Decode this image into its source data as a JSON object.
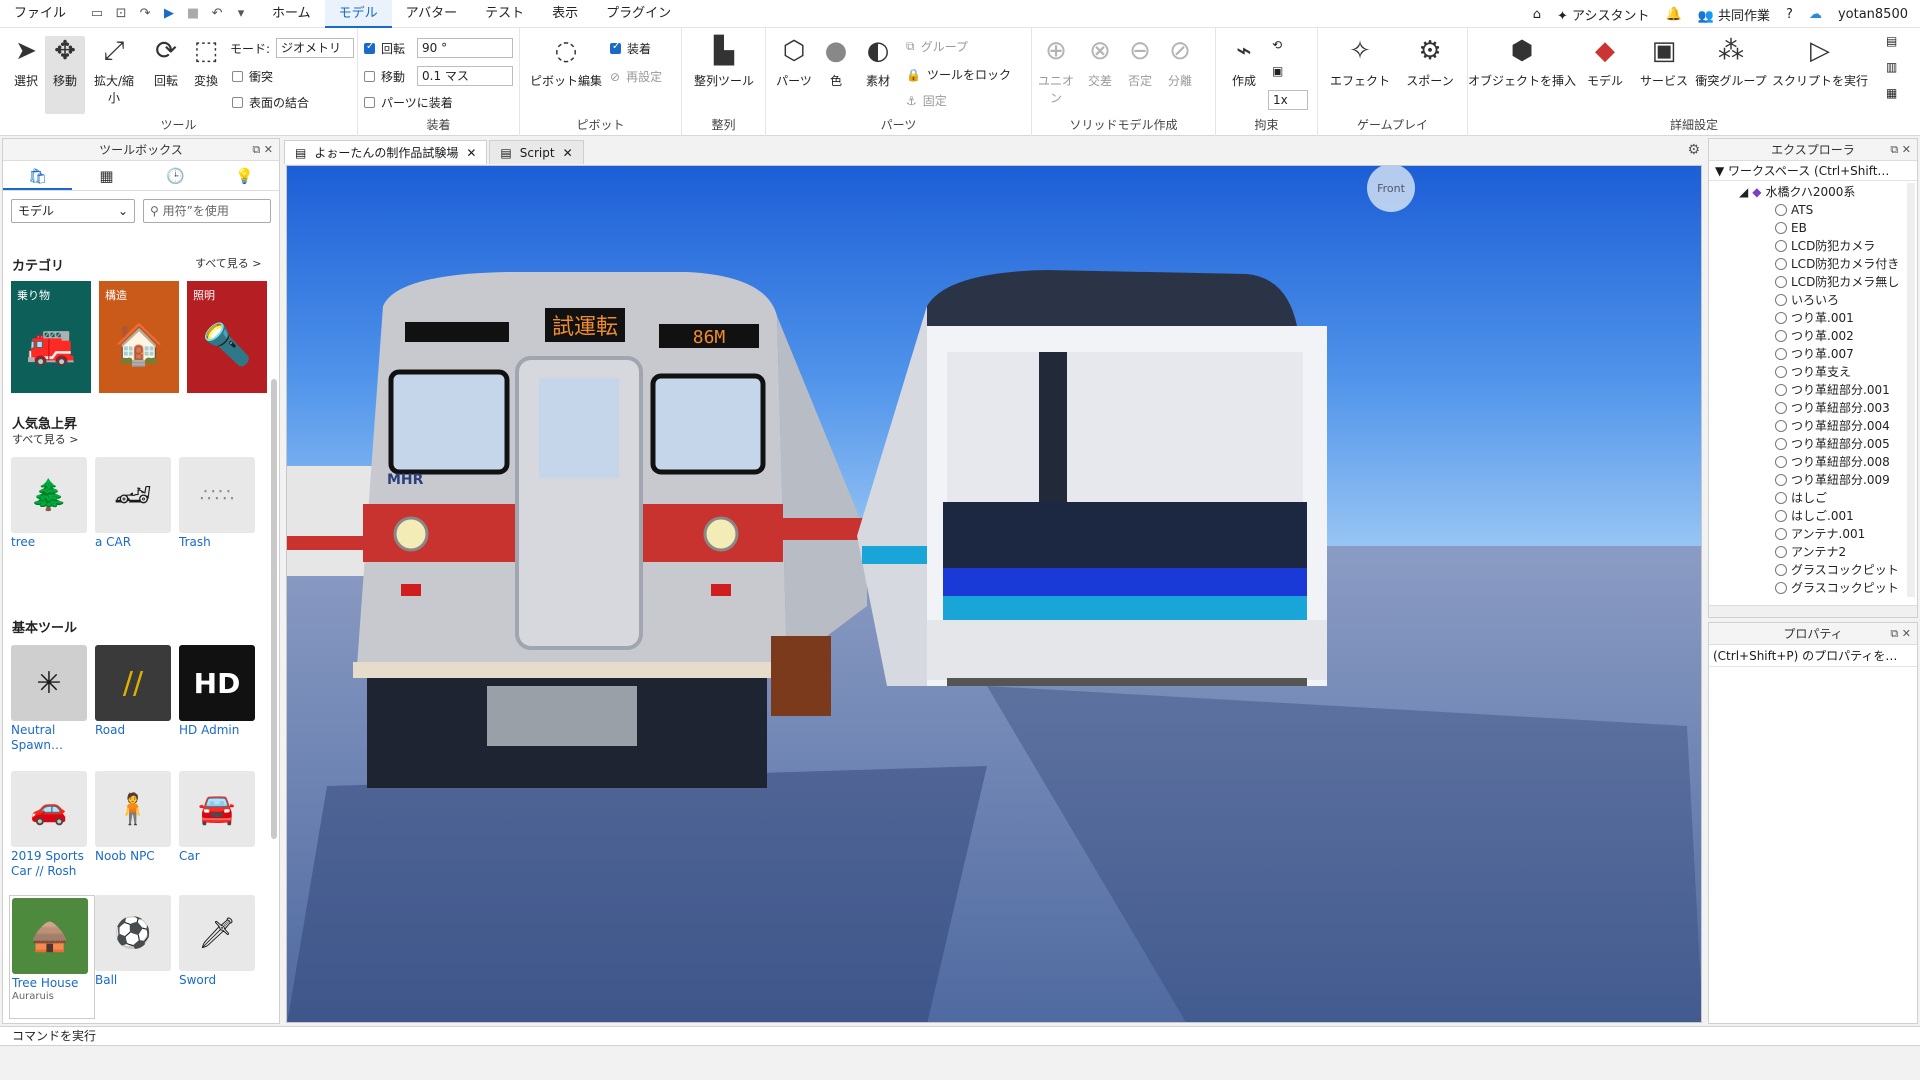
{
  "menubar": {
    "items": [
      "ファイル",
      "ホーム",
      "モデル",
      "アバター",
      "テスト",
      "表示",
      "プラグイン"
    ],
    "active_index": 2,
    "assistant": "アシスタント",
    "collab": "共同作業",
    "username": "yotan8500"
  },
  "ribbon": {
    "tools_group": {
      "label": "ツール",
      "select": "選択",
      "move": "移動",
      "scale": "拡大/縮小",
      "rotate": "回転",
      "transform": "変換",
      "mode_label": "モード:",
      "mode_value": "ジオメトリ",
      "collision": "衝突",
      "join_surfaces": "表面の結合"
    },
    "snap_group": {
      "label": "装着",
      "rotate_label": "回転",
      "rotate_value": "90 °",
      "move_label": "移動",
      "move_value": "0.1 マス",
      "attach_parts": "パーツに装着"
    },
    "pivot_group": {
      "label": "ピボット",
      "edit_pivot": "ピボット編集",
      "attach": "装着",
      "reset": "再設定"
    },
    "align_group": {
      "label": "整列",
      "align_tool": "整列ツール"
    },
    "parts_group": {
      "label": "パーツ",
      "part": "パーツ",
      "color": "色",
      "material": "素材",
      "group": "グループ",
      "lock_tool": "ツールをロック",
      "anchor": "固定"
    },
    "solid_group": {
      "label": "ソリッドモデル作成",
      "union": "ユニオン",
      "intersect": "交差",
      "negate": "否定",
      "separate": "分離"
    },
    "constraint_group": {
      "label": "拘束",
      "create": "作成",
      "scale_value": "1x"
    },
    "gameplay_group": {
      "label": "ゲームプレイ",
      "effects": "エフェクト",
      "spawn": "スポーン"
    },
    "advanced_group": {
      "label": "詳細設定",
      "insert_object": "オブジェクトを挿入",
      "model": "モデル",
      "service": "サービス",
      "collision_groups": "衝突グループ",
      "run_script": "スクリプトを実行"
    }
  },
  "toolbox": {
    "title": "ツールボックス",
    "dropdown": "モデル",
    "search_placeholder": "用符”を使用",
    "categories_heading": "カテゴリ",
    "see_all": "すべて見る >",
    "categories": [
      "乗り物",
      "構造",
      "照明"
    ],
    "trending_heading": "人気急上昇",
    "trending_see_all": "すべて見る >",
    "trending": [
      "tree",
      "a CAR",
      "Trash"
    ],
    "basic_heading": "基本ツール",
    "basic": [
      {
        "name": "Neutral Spawn…"
      },
      {
        "name": "Road"
      },
      {
        "name": "HD Admin"
      },
      {
        "name": "2019 Sports Car // Rosh"
      },
      {
        "name": "Noob NPC"
      },
      {
        "name": "Car"
      },
      {
        "name": "Tree House",
        "sub": "Auraruis"
      },
      {
        "name": "Ball"
      },
      {
        "name": "Sword"
      }
    ]
  },
  "tabs": {
    "place": "よぉーたんの制作品試験場",
    "script": "Script"
  },
  "viewport": {
    "dest_sign": "試運転",
    "run_number": "86M",
    "logo": "MHR",
    "view_cube": "Front"
  },
  "explorer": {
    "title": "エクスプローラ",
    "workspace": "ワークスペース (Ctrl+Shift…",
    "root": "水橋クハ2000系",
    "items": [
      "ATS",
      "EB",
      "LCD防犯カメラ",
      "LCD防犯カメラ付き",
      "LCD防犯カメラ無し",
      "いろいろ",
      "つり革.001",
      "つり革.002",
      "つり革.007",
      "つり革支え",
      "つり革紐部分.001",
      "つり革紐部分.003",
      "つり革紐部分.004",
      "つり革紐部分.005",
      "つり革紐部分.008",
      "つり革紐部分.009",
      "はしご",
      "はしご.001",
      "アンテナ.001",
      "アンテナ2",
      "グラスコックピット",
      "グラスコックピット"
    ]
  },
  "properties": {
    "title": "プロパティ",
    "filter": "(Ctrl+Shift+P) のプロパティを…"
  },
  "command_bar": "コマンドを実行"
}
